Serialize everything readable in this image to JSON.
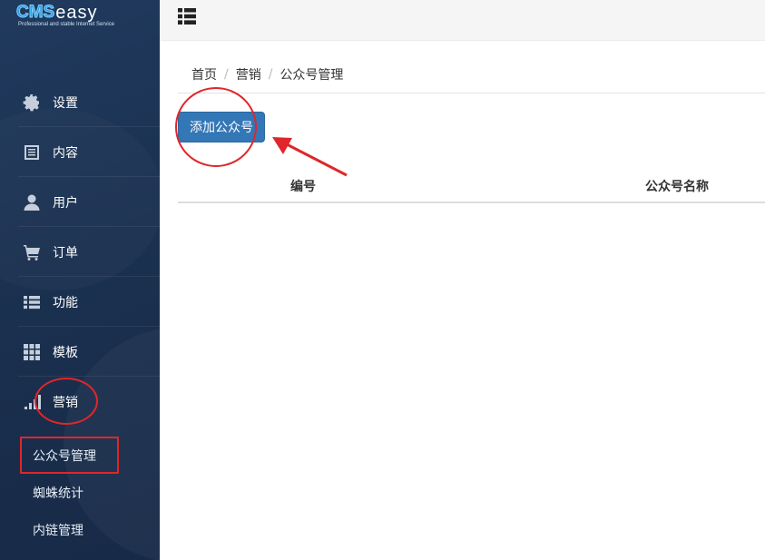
{
  "logo": {
    "brand_main": "CMS",
    "brand_rest": "easy",
    "tagline": "Professional and stable Internet Service"
  },
  "sidebar": {
    "items": [
      {
        "label": "设置",
        "icon": "gear-icon"
      },
      {
        "label": "内容",
        "icon": "document-icon"
      },
      {
        "label": "用户",
        "icon": "user-icon"
      },
      {
        "label": "订单",
        "icon": "cart-icon"
      },
      {
        "label": "功能",
        "icon": "list-icon"
      },
      {
        "label": "模板",
        "icon": "grid-icon"
      },
      {
        "label": "营销",
        "icon": "signal-bars-icon"
      }
    ],
    "subitems": [
      {
        "label": "公众号管理",
        "active": true
      },
      {
        "label": "蜘蛛统计",
        "active": false
      },
      {
        "label": "内链管理",
        "active": false
      }
    ]
  },
  "topbar": {
    "toggle_icon": "list-toggle-icon"
  },
  "breadcrumb": {
    "items": [
      "首页",
      "营销",
      "公众号管理"
    ],
    "separator": "/"
  },
  "main": {
    "add_button_label": "添加公众号",
    "table": {
      "columns": [
        "编号",
        "公众号名称"
      ],
      "rows": []
    }
  },
  "colors": {
    "sidebar_bg": "#1b3150",
    "primary_button": "#3377b7",
    "annotation_red": "#e0262a"
  }
}
